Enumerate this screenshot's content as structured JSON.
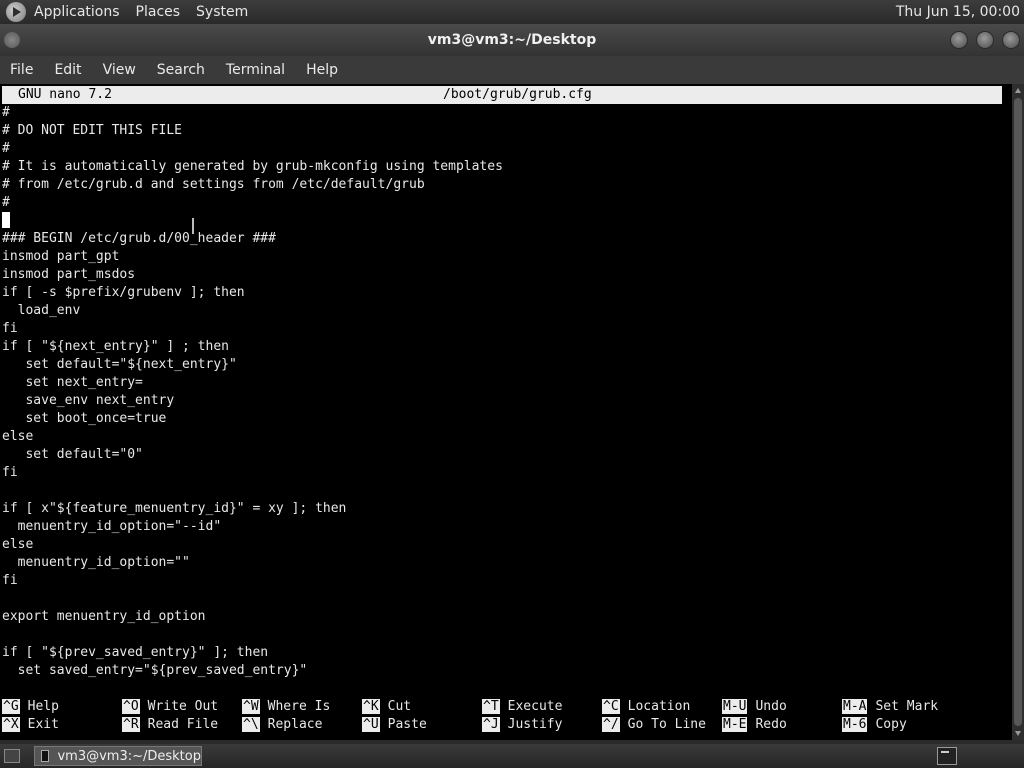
{
  "top_panel": {
    "menus": [
      "Applications",
      "Places",
      "System"
    ],
    "clock": "Thu Jun 15, 00:00"
  },
  "window": {
    "title": "vm3@vm3:~/Desktop"
  },
  "menubar": [
    "File",
    "Edit",
    "View",
    "Search",
    "Terminal",
    "Help"
  ],
  "nano": {
    "version": "GNU nano 7.2",
    "filename": "/boot/grub/grub.cfg",
    "lines": [
      "#",
      "# DO NOT EDIT THIS FILE",
      "#",
      "# It is automatically generated by grub-mkconfig using templates",
      "# from /etc/grub.d and settings from /etc/default/grub",
      "#",
      "",
      "### BEGIN /etc/grub.d/00_header ###",
      "insmod part_gpt",
      "insmod part_msdos",
      "if [ -s $prefix/grubenv ]; then",
      "  load_env",
      "fi",
      "if [ \"${next_entry}\" ] ; then",
      "   set default=\"${next_entry}\"",
      "   set next_entry=",
      "   save_env next_entry",
      "   set boot_once=true",
      "else",
      "   set default=\"0\"",
      "fi",
      "",
      "if [ x\"${feature_menuentry_id}\" = xy ]; then",
      "  menuentry_id_option=\"--id\"",
      "else",
      "  menuentry_id_option=\"\"",
      "fi",
      "",
      "export menuentry_id_option",
      "",
      "if [ \"${prev_saved_entry}\" ]; then",
      "  set saved_entry=\"${prev_saved_entry}\""
    ],
    "shortcuts": [
      {
        "key": "^G",
        "label": "Help"
      },
      {
        "key": "^X",
        "label": "Exit"
      },
      {
        "key": "^O",
        "label": "Write Out"
      },
      {
        "key": "^R",
        "label": "Read File"
      },
      {
        "key": "^W",
        "label": "Where Is"
      },
      {
        "key": "^\\",
        "label": "Replace"
      },
      {
        "key": "^K",
        "label": "Cut"
      },
      {
        "key": "^U",
        "label": "Paste"
      },
      {
        "key": "^T",
        "label": "Execute"
      },
      {
        "key": "^J",
        "label": "Justify"
      },
      {
        "key": "^C",
        "label": "Location"
      },
      {
        "key": "^/",
        "label": "Go To Line"
      },
      {
        "key": "M-U",
        "label": "Undo"
      },
      {
        "key": "M-E",
        "label": "Redo"
      },
      {
        "key": "M-A",
        "label": "Set Mark"
      },
      {
        "key": "M-6",
        "label": "Copy"
      }
    ]
  },
  "taskbar": {
    "task_label": "vm3@vm3:~/Desktop"
  },
  "colors": {
    "terminal_bg": "#000000",
    "terminal_fg": "#e8e8e8",
    "nano_bar": "#ececec"
  }
}
